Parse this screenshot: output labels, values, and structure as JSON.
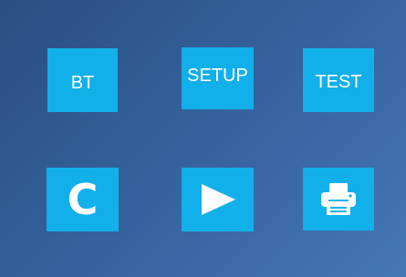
{
  "panel": {
    "buttons": {
      "bt": {
        "label": "BT"
      },
      "setup": {
        "label": "SETUP"
      },
      "test": {
        "label": "TEST"
      },
      "clear": {
        "label": "C"
      },
      "play": {
        "icon": "play-icon"
      },
      "print": {
        "icon": "printer-icon"
      }
    },
    "colors": {
      "tile": "#12b0ea",
      "tile_text": "#ffffff",
      "background_start": "#2a4f82",
      "background_end": "#4576b6"
    }
  }
}
